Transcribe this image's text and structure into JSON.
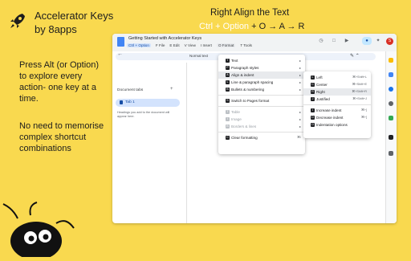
{
  "brand": {
    "title": "Accelerator Keys",
    "subtitle": "by 8apps",
    "icon": "rocket-icon"
  },
  "copy": {
    "intro": "Press Alt (or Option) to explore every action- one key at a time.",
    "note": "No need to memorise complex shortcut combinations"
  },
  "headline": {
    "title": "Right Align the Text",
    "shortcut_prefix": "Ctrl + Option",
    "shortcut_plus": " + ",
    "shortcut_keys": "O → A → R"
  },
  "window": {
    "doc_title": "Getting Started with Accelerator Keys",
    "menu": {
      "chip": "Ctrl + Option",
      "items": [
        "F File",
        "E Edit",
        "V View",
        "I Insert",
        "O Format",
        "T Tools"
      ]
    },
    "toolbar_text": "Normal text",
    "avatar_letter": "S",
    "side": {
      "tabs_label": "Document tabs",
      "add": "+",
      "tab1": "Tab 1",
      "hint": "Headings you add to the document will appear here."
    }
  },
  "format_menu": [
    {
      "key": "T",
      "label": "Text",
      "arrow": "▸"
    },
    {
      "key": "P",
      "label": "Paragraph styles",
      "arrow": "▸"
    },
    {
      "key": "A",
      "label": "Align & indent",
      "arrow": "▸"
    },
    {
      "key": "L",
      "label": "Line & paragraph spacing",
      "arrow": "▸"
    },
    {
      "key": "B",
      "label": "Bullets & numbering",
      "arrow": "▸"
    },
    {
      "key": "S",
      "label": "Switch to Pages format"
    },
    {
      "key": "T",
      "label": "Table",
      "arrow": "▸"
    },
    {
      "key": "I",
      "label": "Image",
      "arrow": "▸"
    },
    {
      "key": "B",
      "label": "Borders & lines",
      "arrow": "▸"
    },
    {
      "key": "C",
      "label": "Clear formatting",
      "shortcut": "⌘\\"
    }
  ],
  "align_menu": [
    {
      "key": "L",
      "label": "Left",
      "shortcut": "⌘+Shift+L"
    },
    {
      "key": "C",
      "label": "Center",
      "shortcut": "⌘+Shift+E"
    },
    {
      "key": "R",
      "label": "Right",
      "shortcut": "⌘+Shift+R"
    },
    {
      "key": "J",
      "label": "Justified",
      "shortcut": "⌘+Shift+J"
    },
    {
      "key": "I",
      "label": "Increase indent",
      "shortcut": "⌘+]"
    },
    {
      "key": "D",
      "label": "Decrease indent",
      "shortcut": "⌘+["
    },
    {
      "key": "O",
      "label": "Indentation options"
    }
  ],
  "colors": {
    "background": "#f9d94f",
    "accent": "#1a73e8",
    "highlight": "#e8eaed"
  }
}
